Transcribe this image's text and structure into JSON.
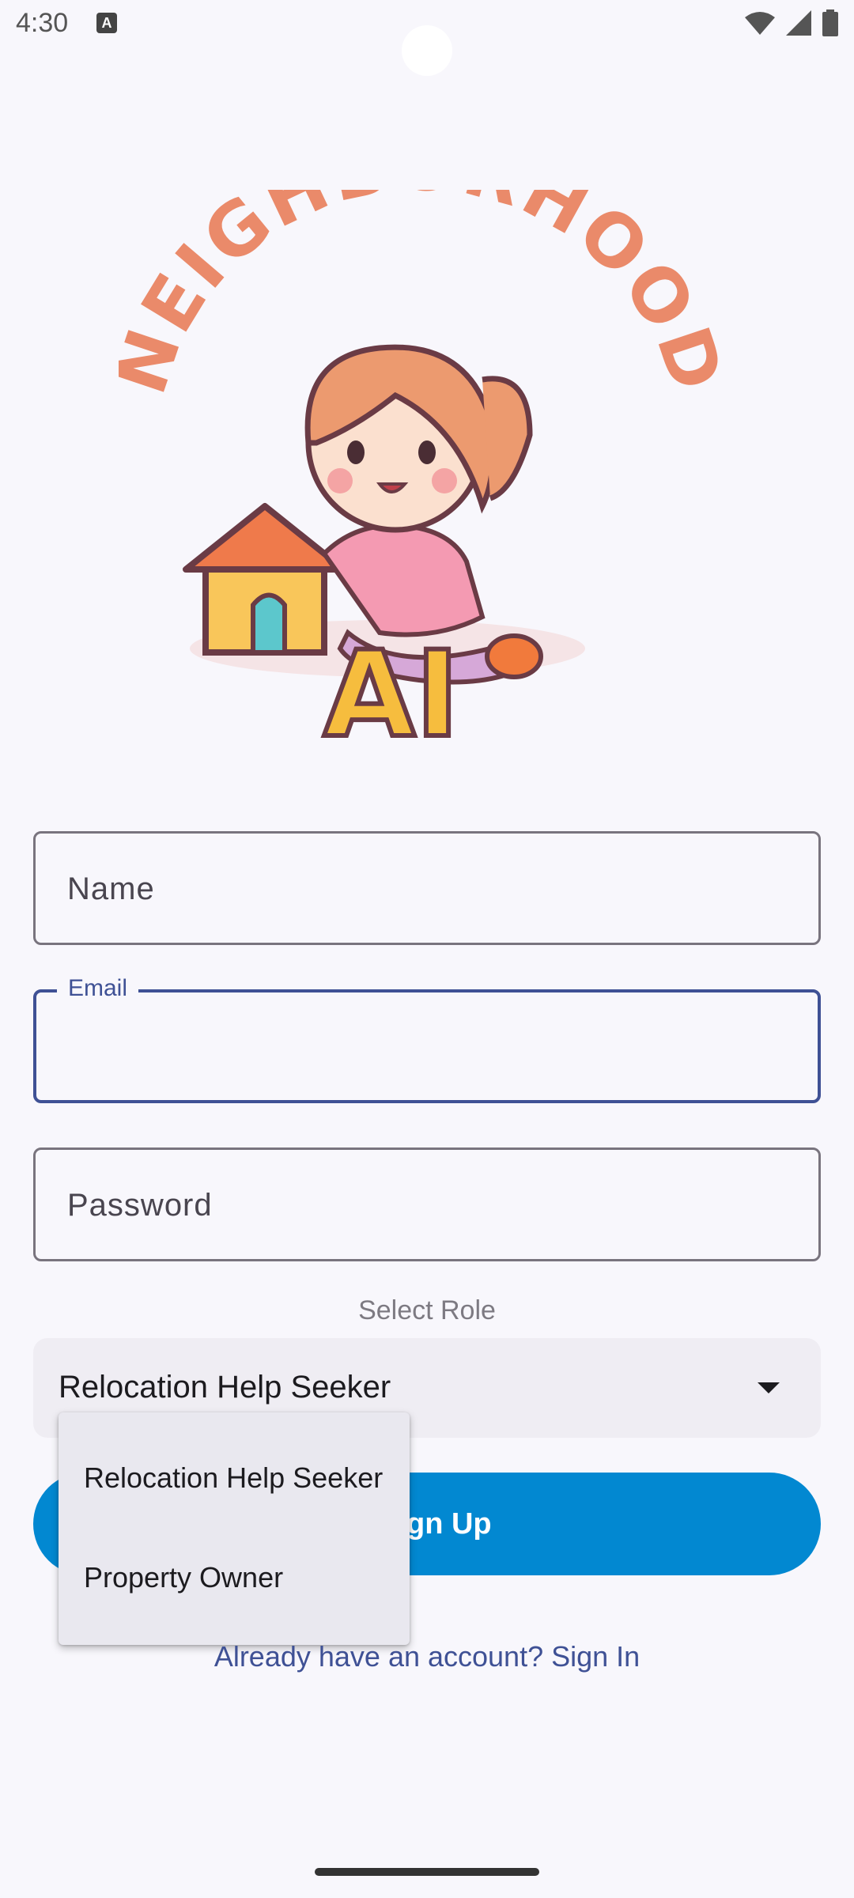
{
  "status_bar": {
    "time": "4:30",
    "notification_badge": "A"
  },
  "logo": {
    "arc_text": "NEIGHBORHOOD",
    "sub_text": "AI",
    "colors": {
      "orange": "#ea8a6a",
      "purple": "#c49ccc",
      "yellow": "#f6bd3e"
    }
  },
  "form": {
    "name_placeholder": "Name",
    "email_label": "Email",
    "email_value": "",
    "password_placeholder": "Password",
    "select_role_label": "Select Role",
    "role_selected": "Relocation Help Seeker",
    "signup_label": "Sign Up",
    "signup_visible_label": "gn Up"
  },
  "menu": {
    "items": [
      {
        "label": "Relocation Help Seeker"
      },
      {
        "label": "Property Owner"
      }
    ]
  },
  "signin_link": "Already have an account? Sign In",
  "colors": {
    "accent": "#3f5195",
    "button": "#0288d1",
    "background": "#f8f7fc"
  }
}
